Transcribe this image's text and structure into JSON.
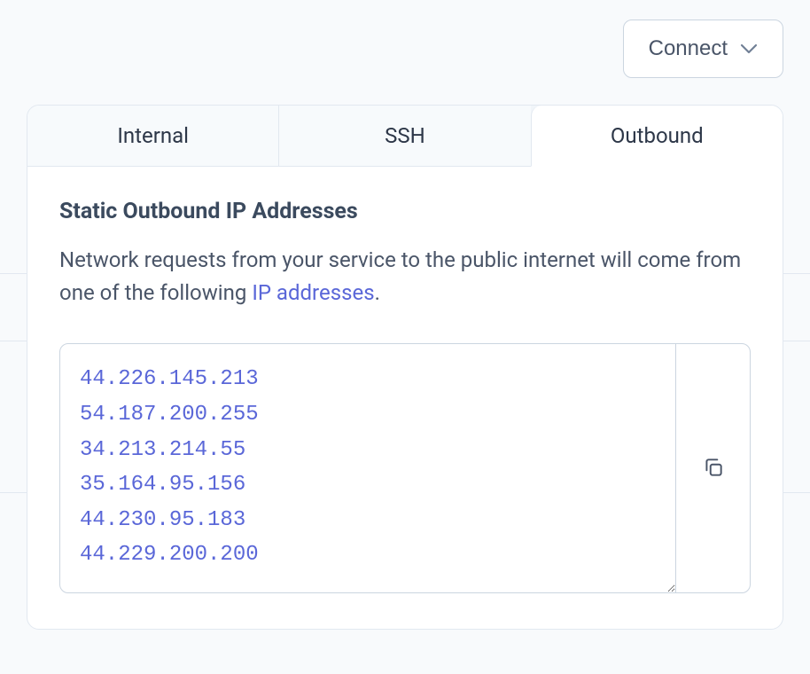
{
  "header": {
    "connect_label": "Connect"
  },
  "tabs": [
    {
      "label": "Internal",
      "active": false
    },
    {
      "label": "SSH",
      "active": false
    },
    {
      "label": "Outbound",
      "active": true
    }
  ],
  "outbound": {
    "title": "Static Outbound IP Addresses",
    "description_prefix": "Network requests from your service to the public internet will come from one of the following ",
    "description_link_text": "IP addresses",
    "description_suffix": ".",
    "ip_addresses": [
      "44.226.145.213",
      "54.187.200.255",
      "34.213.214.55",
      "35.164.95.156",
      "44.230.95.183",
      "44.229.200.200"
    ]
  },
  "colors": {
    "accent": "#5a67d8",
    "border": "#cbd5e0",
    "text": "#4a5568",
    "heading": "#3b4a5e"
  }
}
